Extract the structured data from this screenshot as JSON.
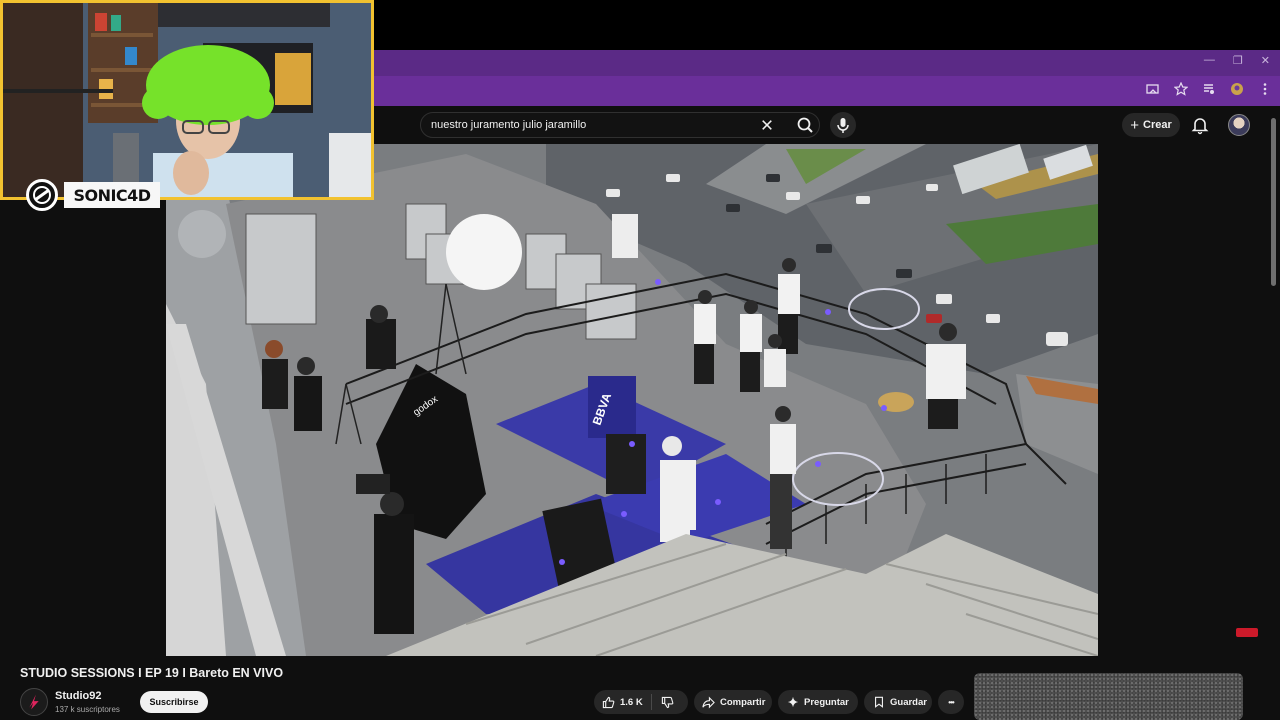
{
  "webcam": {
    "logo_text": "SONIC4D"
  },
  "search": {
    "query": "nuestro juramento julio jaramillo"
  },
  "masthead": {
    "create_label": "Crear"
  },
  "video": {
    "title": "STUDIO SESSIONS I EP 19 I Bareto EN VIVO",
    "banner_text": "BBVA",
    "softbox_brand": "godox"
  },
  "channel": {
    "name": "Studio92",
    "subscribers": "137 k suscriptores",
    "subscribe_label": "Suscribirse"
  },
  "actions": {
    "like_count": "1.6 K",
    "share_label": "Compartir",
    "ask_label": "Preguntar",
    "save_label": "Guardar",
    "more_label": "•••"
  },
  "colors": {
    "webcam_border": "#f2c230",
    "browser_frame": "#6a2f9a",
    "stage_carpet": "#3a3aa8"
  }
}
